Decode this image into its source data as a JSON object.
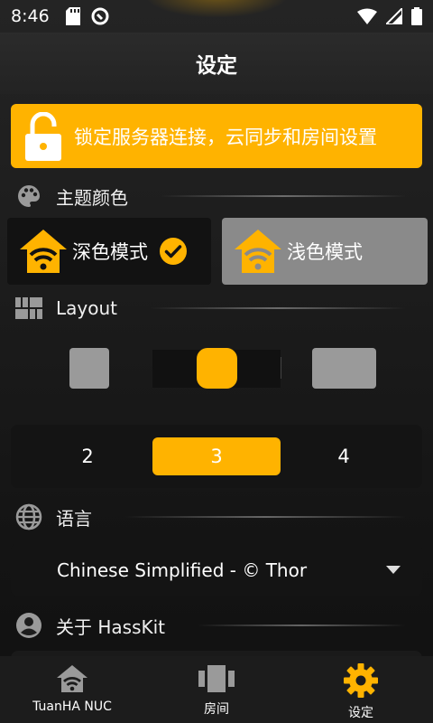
{
  "status": {
    "time": "8:46"
  },
  "header": {
    "title": "设定"
  },
  "lock_banner": {
    "label": "锁定服务器连接，云同步和房间设置"
  },
  "theme": {
    "section_label": "主题颜色",
    "dark_label": "深色模式",
    "light_label": "浅色模式",
    "selected": "dark"
  },
  "layout": {
    "section_label": "Layout",
    "selected_index": 1
  },
  "columns": {
    "options": [
      "2",
      "3",
      "4"
    ],
    "selected": "3"
  },
  "language": {
    "section_label": "语言",
    "selected": "Chinese Simplified - © Thor"
  },
  "about": {
    "section_label": "关于 HassKit"
  },
  "nav": {
    "items": [
      {
        "label": "TuanHA NUC",
        "icon": "house-wifi-icon"
      },
      {
        "label": "房间",
        "icon": "rooms-icon"
      },
      {
        "label": "设定",
        "icon": "gear-icon"
      }
    ],
    "active_index": 2
  },
  "colors": {
    "accent": "#ffb300",
    "inactive_icon": "#9a9a9a",
    "background": "#1d1d1d"
  }
}
